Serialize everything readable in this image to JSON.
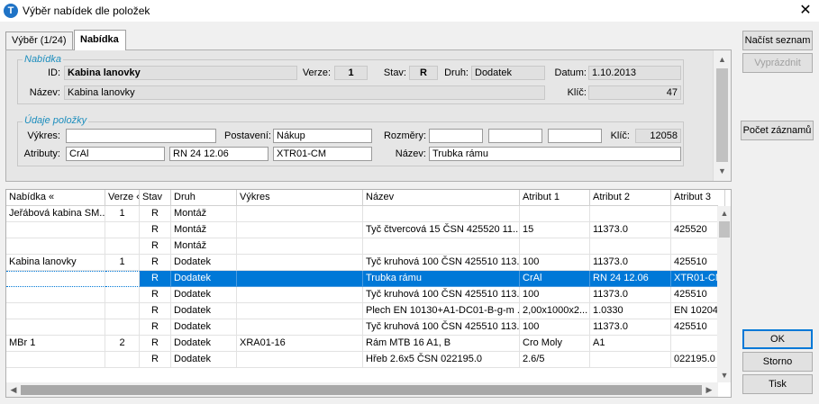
{
  "window": {
    "title": "Výběr nabídek dle položek",
    "app_icon": "T",
    "close": "✕"
  },
  "tabs": [
    {
      "label": "Výběr (1/24)"
    },
    {
      "label": "Nabídka"
    }
  ],
  "nabidka": {
    "legend": "Nabídka",
    "id_label": "ID:",
    "id_value": "Kabina lanovky",
    "verze_label": "Verze:",
    "verze_value": "1",
    "stav_label": "Stav:",
    "stav_value": "R",
    "druh_label": "Druh:",
    "druh_value": "Dodatek",
    "datum_label": "Datum:",
    "datum_value": "1.10.2013",
    "nazev_label": "Název:",
    "nazev_value": "Kabina lanovky",
    "klic_label": "Klíč:",
    "klic_value": "47"
  },
  "polozka": {
    "legend": "Údaje položky",
    "vykres_label": "Výkres:",
    "vykres_value": "",
    "postaveni_label": "Postavení:",
    "postaveni_value": "Nákup",
    "rozmery_label": "Rozměry:",
    "rozmery_values": [
      "",
      "",
      ""
    ],
    "klic_label": "Klíč:",
    "klic_value": "12058",
    "atributy_label": "Atributy:",
    "atributy_values": [
      "CrAl",
      "RN 24 12.06",
      "XTR01-CM"
    ],
    "nazev_label": "Název:",
    "nazev_value": "Trubka rámu"
  },
  "buttons": {
    "nacist": "Načíst seznam",
    "vyprazdnit": "Vyprázdnit",
    "pocet": "Počet záznamů",
    "ok": "OK",
    "storno": "Storno",
    "tisk": "Tisk"
  },
  "grid": {
    "columns": [
      "Nabídka «",
      "Verze «",
      "Stav",
      "Druh",
      "Výkres",
      "Název",
      "Atribut 1",
      "Atribut 2",
      "Atribut 3"
    ],
    "rows": [
      [
        "Jeřábová kabina SM...",
        "1",
        "R",
        "Montáž",
        "",
        "",
        "",
        "",
        ""
      ],
      [
        "",
        "",
        "R",
        "Montáž",
        "",
        "Tyč čtvercová 15 ČSN 425520 11...",
        "15",
        "11373.0",
        "425520"
      ],
      [
        "",
        "",
        "R",
        "Montáž",
        "",
        "",
        "",
        "",
        ""
      ],
      [
        "Kabina lanovky",
        "1",
        "R",
        "Dodatek",
        "",
        "Tyč kruhová 100 ČSN 425510 113...",
        "100",
        "11373.0",
        "425510"
      ],
      [
        "",
        "",
        "R",
        "Dodatek",
        "",
        "Trubka rámu",
        "CrAl",
        "RN 24 12.06",
        "XTR01-CM"
      ],
      [
        "",
        "",
        "R",
        "Dodatek",
        "",
        "Tyč kruhová 100 ČSN 425510 113...",
        "100",
        "11373.0",
        "425510"
      ],
      [
        "",
        "",
        "R",
        "Dodatek",
        "",
        "Plech EN 10130+A1-DC01-B-g-m ...",
        "2,00x1000x2...",
        "1.0330",
        "EN 10204"
      ],
      [
        "",
        "",
        "R",
        "Dodatek",
        "",
        "Tyč kruhová 100 ČSN 425510 113...",
        "100",
        "11373.0",
        "425510"
      ],
      [
        "MBr 1",
        "2",
        "R",
        "Dodatek",
        "XRA01-16",
        "Rám MTB 16 A1, B",
        "Cro Moly",
        "A1",
        ""
      ],
      [
        "",
        "",
        "R",
        "Dodatek",
        "",
        "Hřeb 2.6x5 ČSN 022195.0",
        "2.6/5",
        "",
        "022195.0"
      ]
    ],
    "selected_row": 4
  },
  "icons": {
    "up": "▲",
    "down": "▼",
    "left": "◀",
    "right": "▶"
  }
}
